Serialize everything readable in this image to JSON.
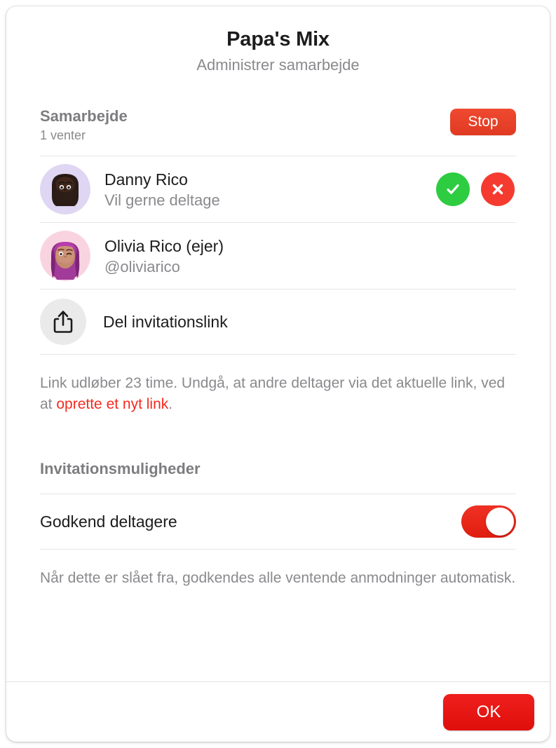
{
  "window": {
    "title": "Papa's Mix",
    "subtitle": "Administrer samarbejde"
  },
  "collaboration": {
    "section_title": "Samarbejde",
    "pending_status": "1 venter",
    "stop_label": "Stop",
    "participants": [
      {
        "name": "Danny Rico",
        "status": "Vil gerne deltage",
        "avatar": "memoji-danny",
        "avatar_bg": "#ded6f2",
        "accept_icon": "check-icon",
        "decline_icon": "x-icon",
        "has_actions": true
      },
      {
        "name": "Olivia Rico (ejer)",
        "status": "@oliviarico",
        "avatar": "memoji-olivia",
        "avatar_bg": "#f9d4e0",
        "has_actions": false
      }
    ],
    "share": {
      "icon": "share-icon",
      "label": "Del invitationslink"
    },
    "note_prefix": "Link udløber 23 time. Undgå, at andre deltager via det aktuelle link, ved at ",
    "note_link": "oprette et nyt link",
    "note_suffix": "."
  },
  "invite_options": {
    "section_title": "Invitationsmuligheder",
    "approve_label": "Godkend deltagere",
    "approve_enabled": true,
    "footnote": "Når dette er slået fra, godkendes alle ventende anmodninger automatisk."
  },
  "footer": {
    "ok_label": "OK"
  },
  "colors": {
    "accent_red": "#e03a22",
    "link_red": "#f42b1f",
    "accept_green": "#2ecc40",
    "decline_red": "#f53b30",
    "toggle_on_red": "#e01e10",
    "divider": "#e6e6e6",
    "muted_text": "#8a8a8e"
  }
}
